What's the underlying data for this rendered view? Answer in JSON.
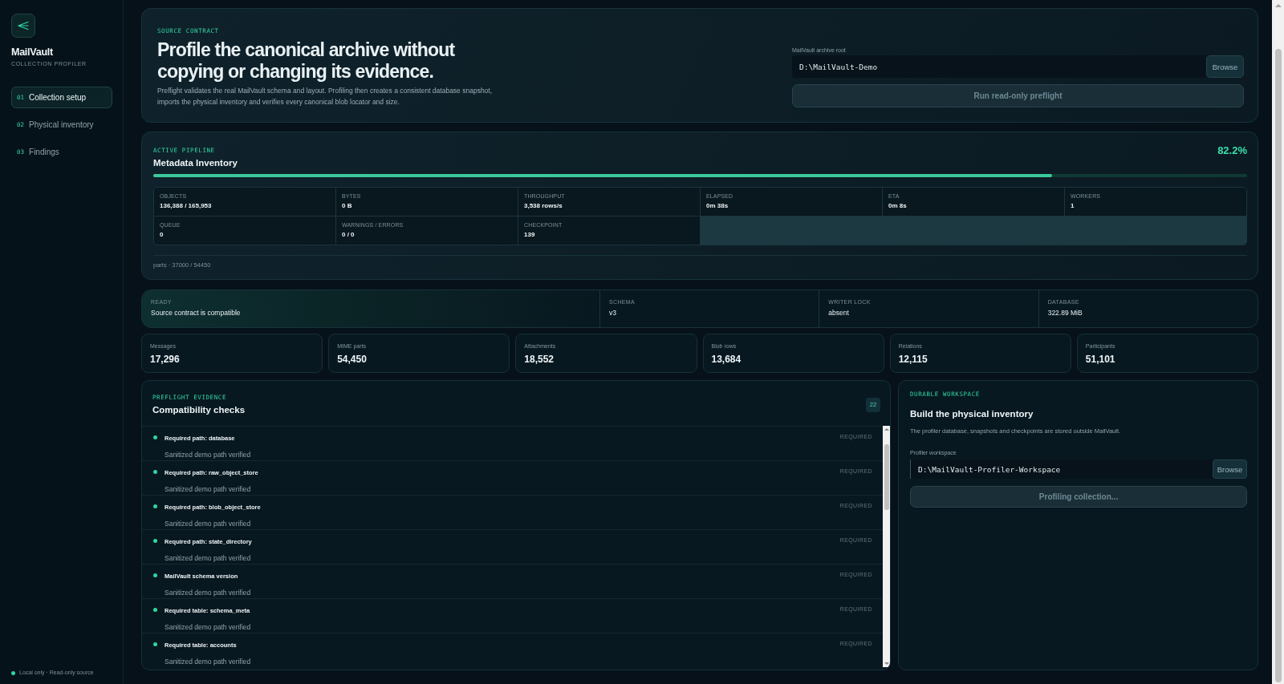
{
  "sidebar": {
    "brand": "MailVault",
    "subtitle": "COLLECTION PROFILER",
    "nav": [
      {
        "number": "01",
        "label": "Collection setup",
        "selected": true
      },
      {
        "number": "02",
        "label": "Physical inventory",
        "selected": false
      },
      {
        "number": "03",
        "label": "Findings",
        "selected": false
      }
    ],
    "footer": "Local only · Read-only source"
  },
  "source_contract": {
    "eyebrow": "SOURCE CONTRACT",
    "title": "Profile the canonical archive without copying or changing its evidence.",
    "description": "Preflight validates the real MailVault schema and layout. Profiling then creates a consistent database snapshot, imports the physical inventory and verifies every canonical blob locator and size.",
    "archive_root": {
      "label": "MailVault archive root",
      "value": "D:\\MailVault-Demo"
    },
    "browse_button": "Browse",
    "run_button": {
      "label": "Run read-only preflight",
      "disabled": true
    }
  },
  "pipeline": {
    "eyebrow": "ACTIVE PIPELINE",
    "title": "Metadata Inventory",
    "percent": "82.2%",
    "level": 0.822,
    "metrics": [
      {
        "label": "OBJECTS",
        "value": "136,388 / 165,953"
      },
      {
        "label": "BYTES",
        "value": "0 B"
      },
      {
        "label": "THROUGHPUT",
        "value": "3,538 rows/s"
      },
      {
        "label": "ELAPSED",
        "value": "0m 38s"
      },
      {
        "label": "ETA",
        "value": "0m 8s"
      },
      {
        "label": "WORKERS",
        "value": "1"
      },
      {
        "label": "QUEUE",
        "value": "0"
      },
      {
        "label": "WARNINGS / ERRORS",
        "value": "0 / 0"
      },
      {
        "label": "CHECKPOINT",
        "value": "139"
      }
    ],
    "footnote": "parts · 37000 / 54450"
  },
  "status": [
    {
      "label": "READY",
      "value": "Source contract is compatible",
      "highlighted": true
    },
    {
      "label": "SCHEMA",
      "value": "v3",
      "highlighted": false
    },
    {
      "label": "WRITER LOCK",
      "value": "absent",
      "highlighted": false
    },
    {
      "label": "DATABASE",
      "value": "322.89 MiB",
      "highlighted": false
    }
  ],
  "counts": [
    {
      "label": "Messages",
      "value": "17,296"
    },
    {
      "label": "MIME parts",
      "value": "54,450"
    },
    {
      "label": "Attachments",
      "value": "18,552"
    },
    {
      "label": "Blob rows",
      "value": "13,684"
    },
    {
      "label": "Relations",
      "value": "12,115"
    },
    {
      "label": "Participants",
      "value": "51,101"
    }
  ],
  "checks": {
    "eyebrow": "PREFLIGHT EVIDENCE",
    "title": "Compatibility checks",
    "count": "22",
    "items": [
      {
        "title": "Required path: database",
        "tag": "REQUIRED",
        "note": "Sanitized demo path verified",
        "passed": true
      },
      {
        "title": "Required path: raw_object_store",
        "tag": "REQUIRED",
        "note": "Sanitized demo path verified",
        "passed": true
      },
      {
        "title": "Required path: blob_object_store",
        "tag": "REQUIRED",
        "note": "Sanitized demo path verified",
        "passed": true
      },
      {
        "title": "Required path: state_directory",
        "tag": "REQUIRED",
        "note": "Sanitized demo path verified",
        "passed": true
      },
      {
        "title": "MailVault schema version",
        "tag": "REQUIRED",
        "note": "Sanitized demo path verified",
        "passed": true
      },
      {
        "title": "Required table: schema_meta",
        "tag": "REQUIRED",
        "note": "Sanitized demo path verified",
        "passed": true
      },
      {
        "title": "Required table: accounts",
        "tag": "REQUIRED",
        "note": "Sanitized demo path verified",
        "passed": true
      }
    ]
  },
  "workspace": {
    "eyebrow": "DURABLE WORKSPACE",
    "title": "Build the physical inventory",
    "description": "The profiler database, snapshots and checkpoints are stored outside MailVault.",
    "field": {
      "label": "Profiler workspace",
      "value": "D:\\MailVault-Profiler-Workspace"
    },
    "browse_button": "Browse",
    "action_button": {
      "label": "Profiling collection...",
      "disabled": true
    }
  }
}
